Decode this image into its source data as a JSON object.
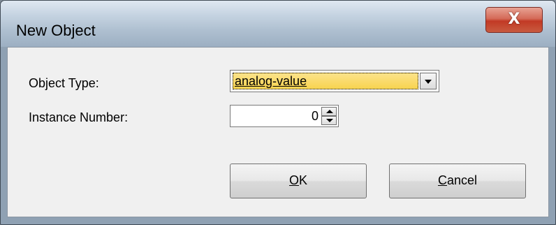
{
  "window": {
    "title": "New Object",
    "close_glyph": "X"
  },
  "form": {
    "object_type_label": "Object Type:",
    "object_type_value": "analog-value",
    "instance_label": "Instance Number:",
    "instance_value": "0"
  },
  "buttons": {
    "ok": {
      "mnemonic": "O",
      "rest": "K"
    },
    "cancel": {
      "mnemonic": "C",
      "rest": "ancel"
    }
  },
  "icons": {
    "close": "close-icon",
    "dropdown": "chevron-down-icon",
    "spin_up": "spin-up-icon",
    "spin_down": "spin-down-icon"
  }
}
